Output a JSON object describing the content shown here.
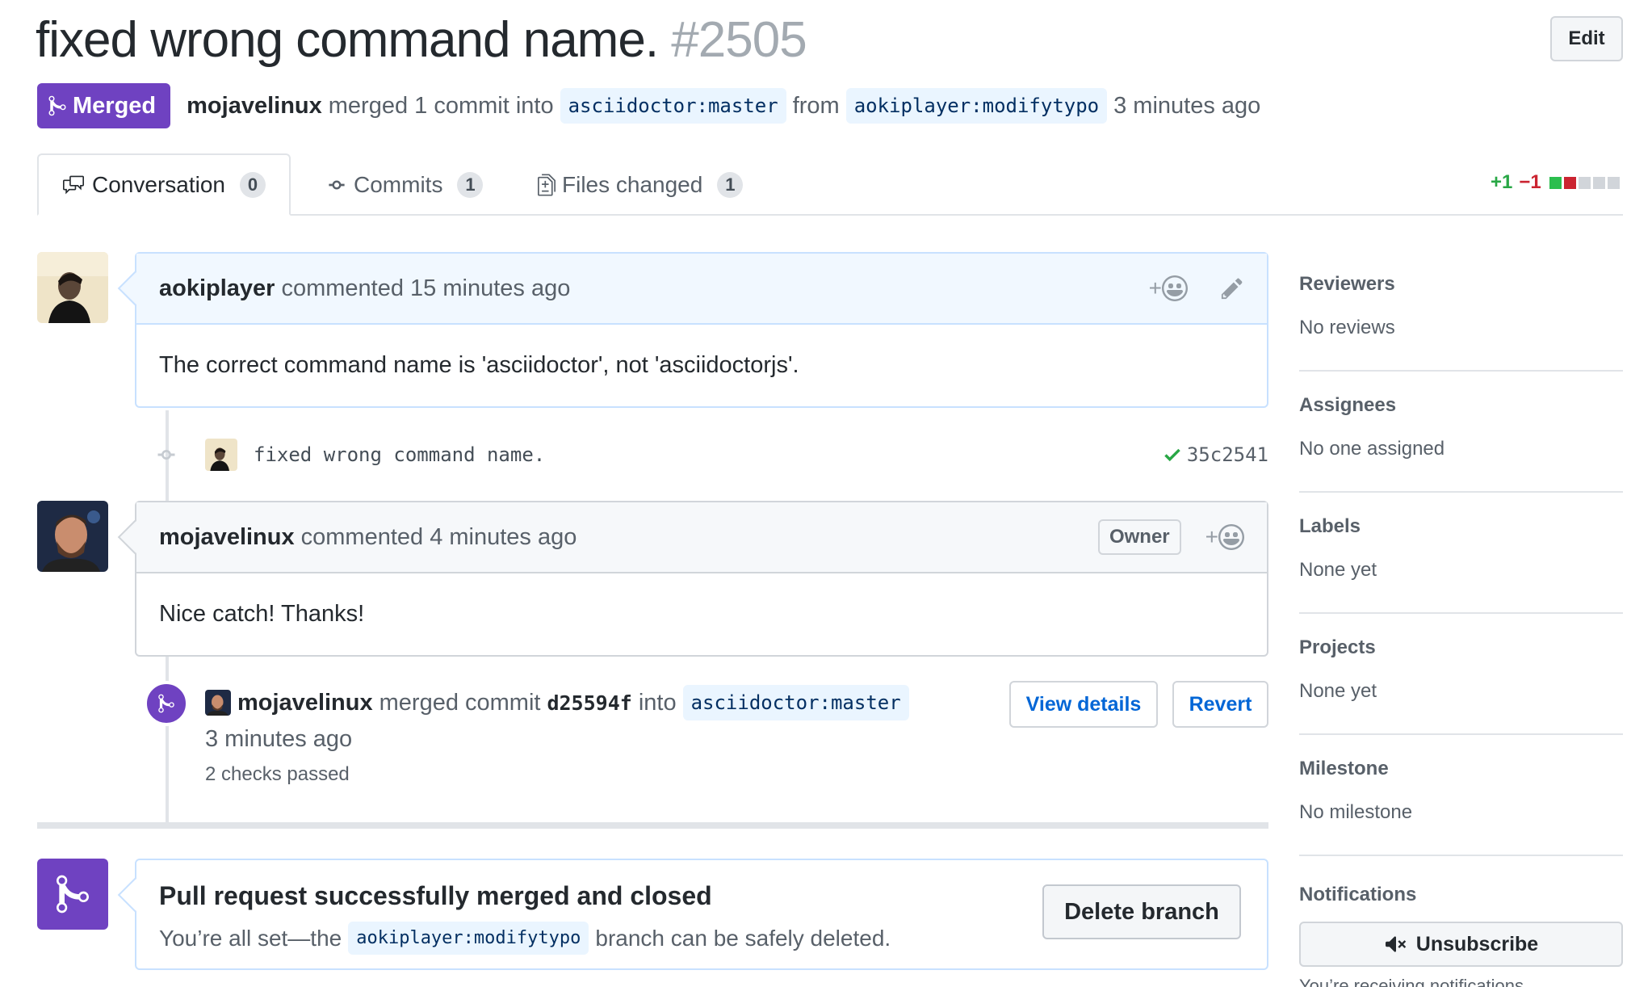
{
  "pr": {
    "title": "fixed wrong command name.",
    "number": "#2505",
    "edit_label": "Edit",
    "status": "Merged",
    "author": "mojavelinux",
    "merge_text": "merged 1 commit into",
    "base_branch": "asciidoctor:master",
    "from_text": "from",
    "head_branch": "aokiplayer:modifytypo",
    "time": "3 minutes ago"
  },
  "tabs": [
    {
      "label": "Conversation",
      "count": "0"
    },
    {
      "label": "Commits",
      "count": "1"
    },
    {
      "label": "Files changed",
      "count": "1"
    }
  ],
  "diffstat": {
    "additions": "+1",
    "deletions": "−1"
  },
  "colors": {
    "merged": "#6f42c1",
    "add": "#28a745",
    "del": "#cb2431",
    "link": "#0366d6"
  },
  "comments": [
    {
      "author": "aokiplayer",
      "meta": "commented 15 minutes ago",
      "body": "The correct command name is 'asciidoctor', not 'asciidoctorjs'.",
      "reaction": "+",
      "icons": [
        "smiley-icon",
        "pencil-icon"
      ]
    },
    {
      "author": "mojavelinux",
      "meta": "commented 4 minutes ago",
      "badge": "Owner",
      "body": "Nice catch! Thanks!",
      "reaction": "+",
      "icons": [
        "smiley-icon"
      ]
    }
  ],
  "commit": {
    "message": "fixed wrong command name.",
    "sha": "35c2541"
  },
  "merge_event": {
    "author": "mojavelinux",
    "text1": "merged commit",
    "sha": "d25594f",
    "text2": "into",
    "branch": "asciidoctor:master",
    "time": "3 minutes ago",
    "checks": "2 checks passed",
    "view_details_label": "View details",
    "revert_label": "Revert"
  },
  "merged_box": {
    "title": "Pull request successfully merged and closed",
    "sub_prefix": "You’re all set—the",
    "branch": "aokiplayer:modifytypo",
    "sub_suffix": "branch can be safely deleted.",
    "delete_label": "Delete branch"
  },
  "sidebar": {
    "sections": [
      {
        "heading": "Reviewers",
        "value": "No reviews"
      },
      {
        "heading": "Assignees",
        "value": "No one assigned"
      },
      {
        "heading": "Labels",
        "value": "None yet"
      },
      {
        "heading": "Projects",
        "value": "None yet"
      },
      {
        "heading": "Milestone",
        "value": "No milestone"
      }
    ],
    "notifications_heading": "Notifications",
    "unsubscribe_label": "Unsubscribe",
    "notifications_note": "You’re receiving notifications"
  }
}
